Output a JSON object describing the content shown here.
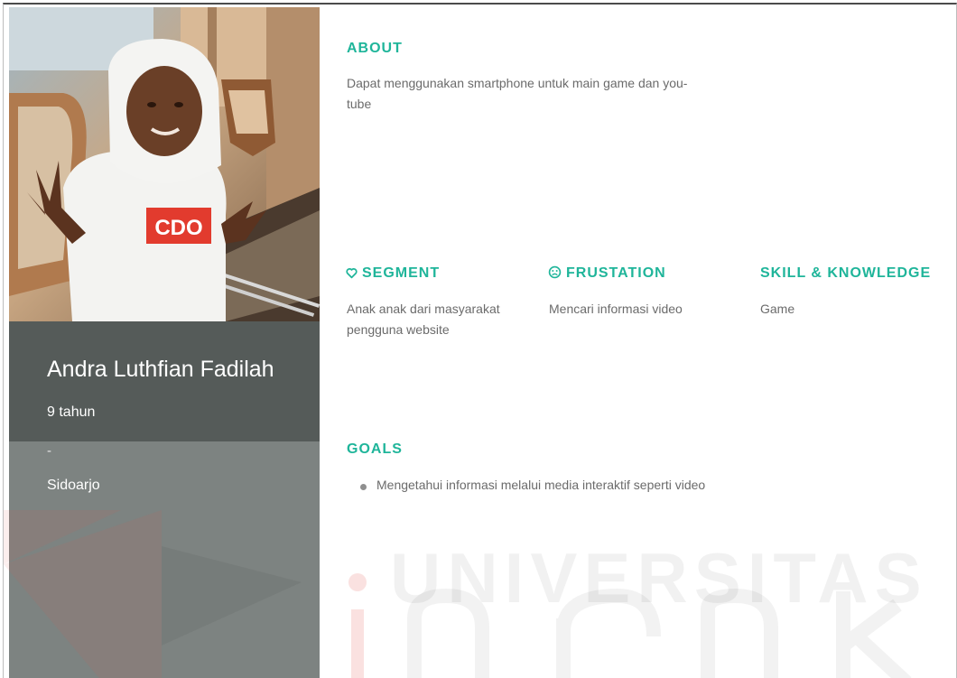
{
  "profile": {
    "name": "Andra Luthfian Fadilah",
    "age": "9 tahun",
    "separator": "-",
    "city": "Sidoarjo",
    "shirt_text": "CDO"
  },
  "about": {
    "heading": "ABOUT",
    "line1": "Dapat menggunakan smartphone untuk main game dan you-",
    "line2": "tube"
  },
  "segment": {
    "heading": "SEGMENT",
    "icon": "heart-outline-icon",
    "line1": "Anak anak dari masyarakat",
    "line2": "pengguna website"
  },
  "frustation": {
    "heading": "FRUSTATION",
    "icon": "sad-face-icon",
    "text": "Mencari informasi video"
  },
  "skill": {
    "heading": "SKILL & KNOWLEDGE",
    "text": "Game"
  },
  "goals": {
    "heading": "GOALS",
    "items": [
      "Mengetahui informasi melalui media interaktif seperti video"
    ]
  },
  "watermark": {
    "text": "UNIVERSITAS",
    "brand": "Dinamika"
  },
  "colors": {
    "accent": "#1fb59a",
    "name_panel": "#555b59",
    "lower_panel": "#7d8381",
    "body_text": "#6b6b6b"
  }
}
